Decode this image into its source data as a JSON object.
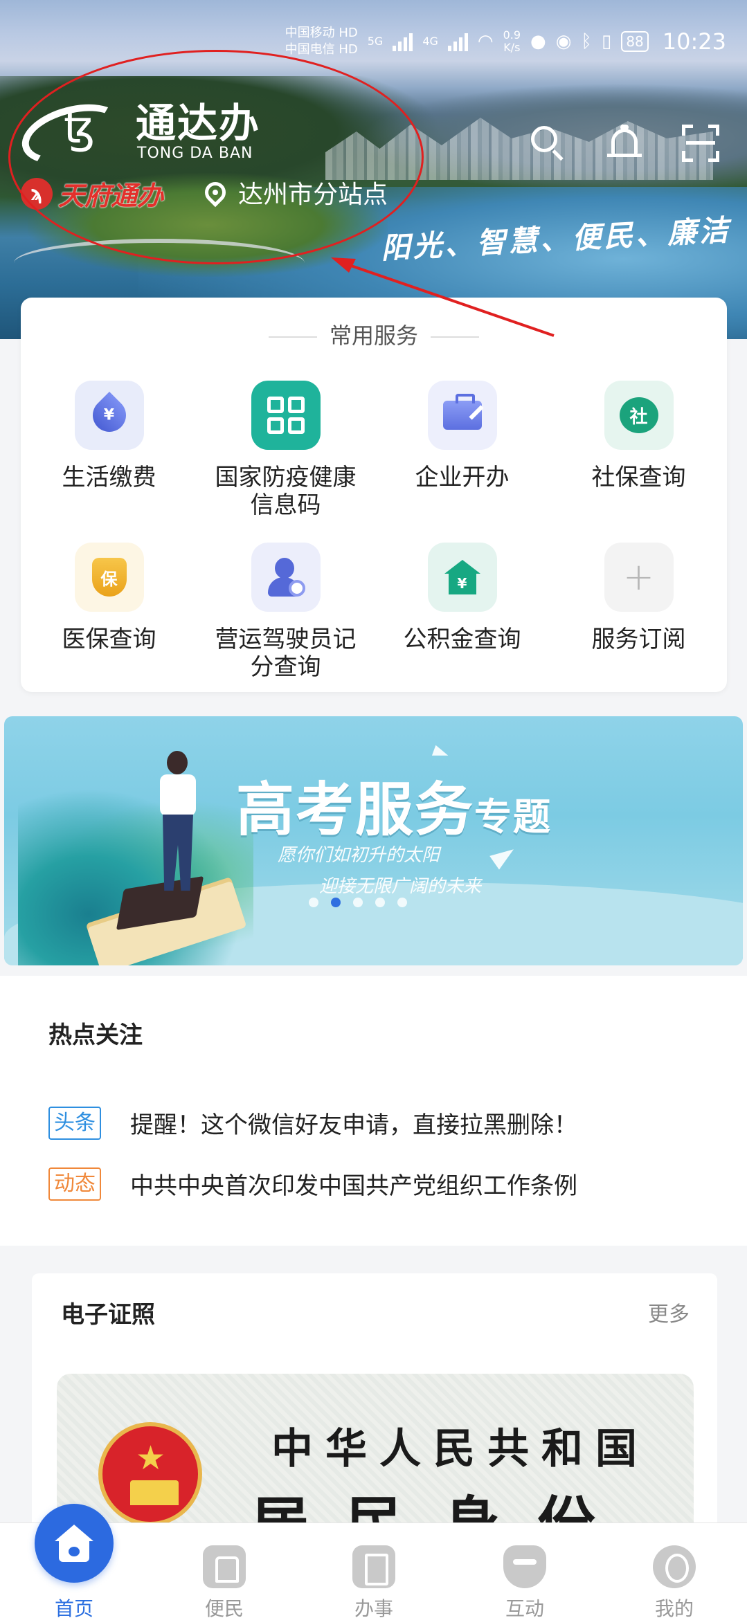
{
  "status_bar": {
    "carrier1": "中国移动",
    "carrier2": "中国电信",
    "hd1": "HD",
    "hd2": "HD",
    "net_speed": "0.9",
    "net_unit": "K/s",
    "network1": "5G",
    "network2": "4G",
    "battery": "88",
    "time": "10:23"
  },
  "header": {
    "app_name": "通达办",
    "app_name_en": "TONG DA BAN",
    "partner_logo_text": "天府通办",
    "station": "达州市分站点",
    "slogan": "阳光、智慧、便民、廉洁",
    "icons": [
      "search-icon",
      "bell-icon",
      "scan-icon"
    ]
  },
  "services": {
    "title": "常用服务",
    "items": [
      {
        "label": "生活缴费",
        "icon": "water-drop-icon",
        "glyph": "¥"
      },
      {
        "label": "国家防疫健康信息码",
        "icon": "qr-code-icon"
      },
      {
        "label": "企业开办",
        "icon": "briefcase-icon"
      },
      {
        "label": "社保查询",
        "icon": "social-security-icon",
        "glyph": "社"
      },
      {
        "label": "医保查询",
        "icon": "medical-shield-icon",
        "glyph": "保"
      },
      {
        "label": "营运驾驶员记分查询",
        "icon": "driver-icon"
      },
      {
        "label": "公积金查询",
        "icon": "housing-fund-icon",
        "glyph": "¥"
      },
      {
        "label": "服务订阅",
        "icon": "plus-icon",
        "glyph": "+"
      }
    ]
  },
  "banner": {
    "title_main": "高考服务",
    "title_small": "专题",
    "line1": "愿你们如初升的太阳",
    "line2": "迎接无限广阔的未来",
    "slides": 5,
    "active_slide": 2
  },
  "hot": {
    "title": "热点关注",
    "items": [
      {
        "tag": "头条",
        "text": "提醒！这个微信好友申请，直接拉黑删除！"
      },
      {
        "tag": "动态",
        "text": "中共中央首次印发中国共产党组织工作条例"
      }
    ]
  },
  "cert": {
    "title": "电子证照",
    "more": "更多",
    "card_line1": "中华人民共和国",
    "card_line2": "居民身份证"
  },
  "nav": {
    "items": [
      {
        "label": "首页",
        "icon": "home-icon",
        "active": true
      },
      {
        "label": "便民",
        "icon": "convenience-icon"
      },
      {
        "label": "办事",
        "icon": "affairs-icon"
      },
      {
        "label": "互动",
        "icon": "interaction-icon"
      },
      {
        "label": "我的",
        "icon": "profile-icon"
      }
    ]
  },
  "colors": {
    "accent": "#2c6ae0",
    "tag_headline": "#2e8fe0",
    "tag_news": "#f0883a",
    "annotation": "#e02020"
  }
}
